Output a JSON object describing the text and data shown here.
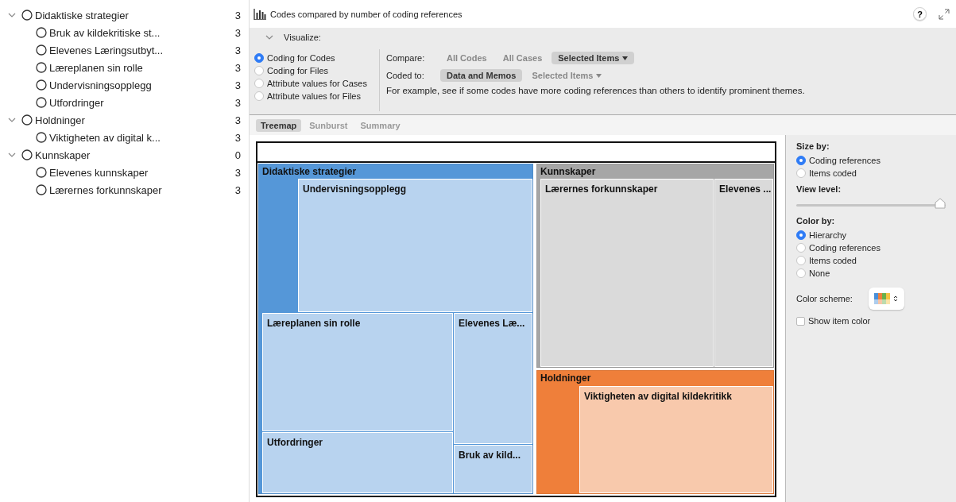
{
  "code_tree": [
    {
      "label": "Didaktiske strategier",
      "count": "3",
      "expanded": true,
      "children": [
        {
          "label": "Bruk av kildekritiske st...",
          "count": "3"
        },
        {
          "label": "Elevenes Læringsutbyt...",
          "count": "3"
        },
        {
          "label": "Læreplanen sin rolle",
          "count": "3"
        },
        {
          "label": "Undervisningsopplegg",
          "count": "3"
        },
        {
          "label": "Utfordringer",
          "count": "3"
        }
      ]
    },
    {
      "label": "Holdninger",
      "count": "3",
      "expanded": true,
      "children": [
        {
          "label": "Viktigheten av digital k...",
          "count": "3"
        }
      ]
    },
    {
      "label": "Kunnskaper",
      "count": "0",
      "expanded": true,
      "children": [
        {
          "label": "Elevenes kunnskaper",
          "count": "3"
        },
        {
          "label": "Lærernes forkunnskaper",
          "count": "3"
        }
      ]
    }
  ],
  "header": {
    "title": "Codes compared by number of coding references",
    "help": "?"
  },
  "visualize": {
    "label": "Visualize:",
    "expanded": true,
    "options": [
      {
        "label": "Coding for Codes",
        "selected": true
      },
      {
        "label": "Coding for Files",
        "selected": false
      },
      {
        "label": "Attribute values for Cases",
        "selected": false
      },
      {
        "label": "Attribute values for Files",
        "selected": false
      }
    ],
    "compare": {
      "label": "Compare:",
      "options": [
        {
          "label": "All Codes",
          "selected": false,
          "dropdown": false
        },
        {
          "label": "All Cases",
          "selected": false,
          "dropdown": false
        },
        {
          "label": "Selected Items",
          "selected": true,
          "dropdown": true
        }
      ]
    },
    "coded_to": {
      "label": "Coded to:",
      "options": [
        {
          "label": "Data and Memos",
          "selected": true,
          "dropdown": false
        },
        {
          "label": "Selected Items",
          "selected": false,
          "dropdown": true
        }
      ]
    },
    "hint": "For example, see if some codes have more coding references than others to identify prominent themes."
  },
  "view_tabs": [
    {
      "label": "Treemap",
      "selected": true
    },
    {
      "label": "Sunburst",
      "selected": false
    },
    {
      "label": "Summary",
      "selected": false
    }
  ],
  "treemap": {
    "groups": [
      {
        "label": "Didaktiske strategier",
        "color": "#5597d8",
        "children": [
          {
            "label": "Undervisningsopplegg"
          },
          {
            "label": "Læreplanen sin rolle"
          },
          {
            "label": "Elevenes Læ..."
          },
          {
            "label": "Utfordringer"
          },
          {
            "label": "Bruk av kild..."
          }
        ]
      },
      {
        "label": "Kunnskaper",
        "color": "#a6a6a6",
        "children": [
          {
            "label": "Lærernes forkunnskaper"
          },
          {
            "label": "Elevenes ..."
          }
        ]
      },
      {
        "label": "Holdninger",
        "color": "#ef7f3a",
        "children": [
          {
            "label": "Viktigheten av digital kildekritikk"
          }
        ]
      }
    ]
  },
  "settings": {
    "size_by": {
      "label": "Size by:",
      "options": [
        {
          "label": "Coding references",
          "selected": true
        },
        {
          "label": "Items coded",
          "selected": false
        }
      ]
    },
    "view_level": {
      "label": "View level:",
      "level": 1
    },
    "color_by": {
      "label": "Color by:",
      "options": [
        {
          "label": "Hierarchy",
          "selected": true
        },
        {
          "label": "Coding references",
          "selected": false
        },
        {
          "label": "Items coded",
          "selected": false
        },
        {
          "label": "None",
          "selected": false
        }
      ]
    },
    "color_scheme": {
      "label": "Color scheme:"
    },
    "show_item_color": {
      "label": "Show item color",
      "checked": false
    }
  }
}
